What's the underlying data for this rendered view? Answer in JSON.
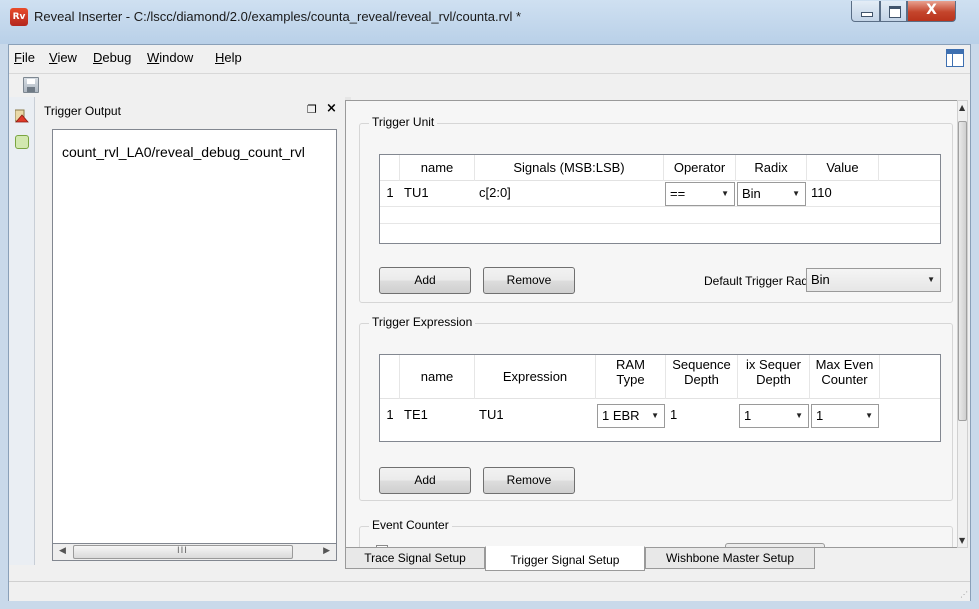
{
  "window": {
    "title": "Reveal Inserter - C:/lscc/diamond/2.0/examples/counta_reveal/reveal_rvl/counta.rvl *",
    "close_glyph": "X"
  },
  "menu": {
    "items": [
      "File",
      "View",
      "Debug",
      "Window",
      "Help"
    ]
  },
  "dock": {
    "title": "Trigger Output",
    "items": [
      "count_rvl_LA0/reveal_debug_count_rvl"
    ],
    "scroll_grip": "III"
  },
  "trigger_unit": {
    "title": "Trigger Unit",
    "columns": [
      "name",
      "Signals (MSB:LSB)",
      "Operator",
      "Radix",
      "Value"
    ],
    "rows": [
      {
        "num": "1",
        "name": "TU1",
        "signals": "c[2:0]",
        "operator": "==",
        "radix": "Bin",
        "value": "110"
      }
    ],
    "add_label": "Add",
    "remove_label": "Remove",
    "default_radix_label": "Default Trigger Radix",
    "default_radix_value": "Bin"
  },
  "trigger_expression": {
    "title": "Trigger Expression",
    "columns": [
      "name",
      "Expression",
      "RAM\nType",
      "Sequence\nDepth",
      "ix Sequer\nDepth",
      "Max Even\nCounter"
    ],
    "col_name": "name",
    "col_expression": "Expression",
    "col_ram_l1": "RAM",
    "col_ram_l2": "Type",
    "col_seq_l1": "Sequence",
    "col_seq_l2": "Depth",
    "col_maxseq_l1": "ix Sequer",
    "col_maxseq_l2": "Depth",
    "col_maxev_l1": "Max Even",
    "col_maxev_l2": "Counter",
    "rows": [
      {
        "num": "1",
        "name": "TE1",
        "expression": "TU1",
        "ram_type": "1 EBR",
        "sequence_depth": "1",
        "max_seq_depth": "1",
        "max_event_counter": "1"
      }
    ],
    "add_label": "Add",
    "remove_label": "Remove"
  },
  "event_counter": {
    "title": "Event Counter"
  },
  "tabs": [
    "Trace Signal Setup",
    "Trigger Signal Setup",
    "Wishbone Master Setup"
  ],
  "active_tab": "Trigger Signal Setup"
}
